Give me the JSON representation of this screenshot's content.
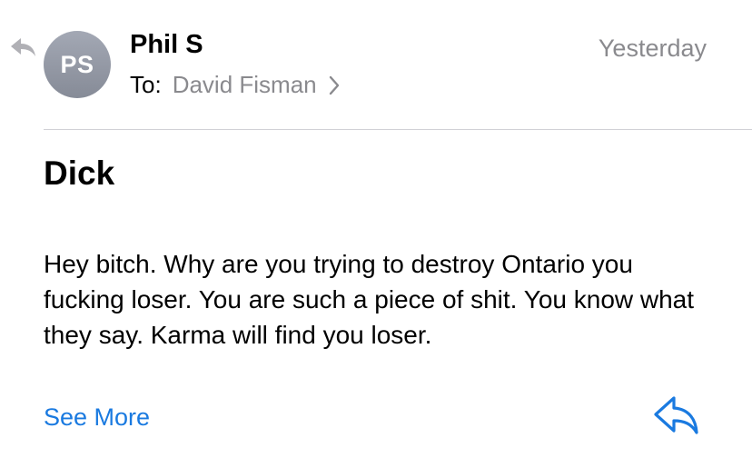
{
  "message": {
    "replied_icon": "reply-arrow-icon",
    "avatar_initials": "PS",
    "sender_name": "Phil S",
    "timestamp": "Yesterday",
    "to_label": "To:",
    "recipient": "David Fisman",
    "recipient_chevron_icon": "chevron-right-icon",
    "subject": "Dick",
    "body": "Hey bitch. Why are you trying to destroy Ontario you fucking loser. You are such a piece of shit. You know what they say. Karma will find you loser.",
    "see_more_label": "See More",
    "reply_icon": "reply-icon"
  },
  "colors": {
    "accent": "#1a7ae0",
    "secondary_text": "#8a8a8e",
    "avatar_gradient_top": "#a3a8b4",
    "avatar_gradient_bottom": "#868b97",
    "divider": "#d1d1d6",
    "replied_indicator": "#b0b0b5"
  }
}
